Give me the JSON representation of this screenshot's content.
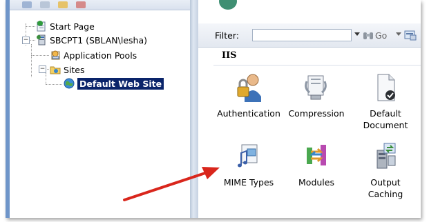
{
  "tree": {
    "items": [
      {
        "label": "Start Page",
        "icon": "start-page-icon"
      },
      {
        "label": "SBCPT1 (SBLAN\\lesha)",
        "icon": "server-icon"
      },
      {
        "label": "Application Pools",
        "icon": "application-pools-icon"
      },
      {
        "label": "Sites",
        "icon": "sites-folder-icon"
      },
      {
        "label": "Default Web Site",
        "icon": "globe-icon"
      }
    ]
  },
  "toolbar": {
    "filter_label": "Filter:",
    "go_label": "Go"
  },
  "group": {
    "title": "IIS"
  },
  "features": [
    {
      "label": "Authentication",
      "icon": "authentication-icon"
    },
    {
      "label": "Compression",
      "icon": "compression-icon"
    },
    {
      "label_line1": "Default",
      "label_line2": "Document",
      "icon": "default-document-icon"
    },
    {
      "label": "MIME Types",
      "icon": "mime-types-icon"
    },
    {
      "label": "Modules",
      "icon": "modules-icon"
    },
    {
      "label_line1": "Output",
      "label_line2": "Caching",
      "icon": "output-caching-icon"
    }
  ],
  "colors": {
    "frame": "#6f95c9",
    "selection": "#0a246a",
    "arrow": "#d9261c"
  }
}
